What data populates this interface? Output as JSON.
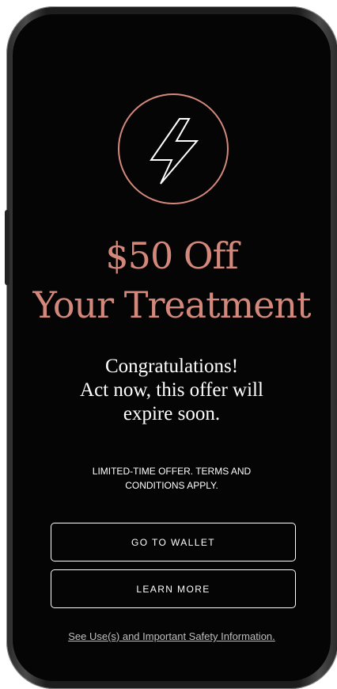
{
  "offer": {
    "icon": "lightning-bolt-icon",
    "headline_line1": "$50 Off",
    "headline_line2": "Your Treatment",
    "message_line1": "Congratulations!",
    "message_line2": "Act now, this offer will",
    "message_line3": "expire soon.",
    "terms_line1": "LIMITED-TIME OFFER. TERMS AND",
    "terms_line2": "CONDITIONS APPLY."
  },
  "actions": {
    "wallet_label": "GO TO WALLET",
    "learn_label": "LEARN MORE"
  },
  "footer": {
    "safety_link": "See Use(s) and Important Safety Information."
  },
  "colors": {
    "accent": "#d4887b",
    "background": "#050505",
    "text": "#ffffff"
  }
}
